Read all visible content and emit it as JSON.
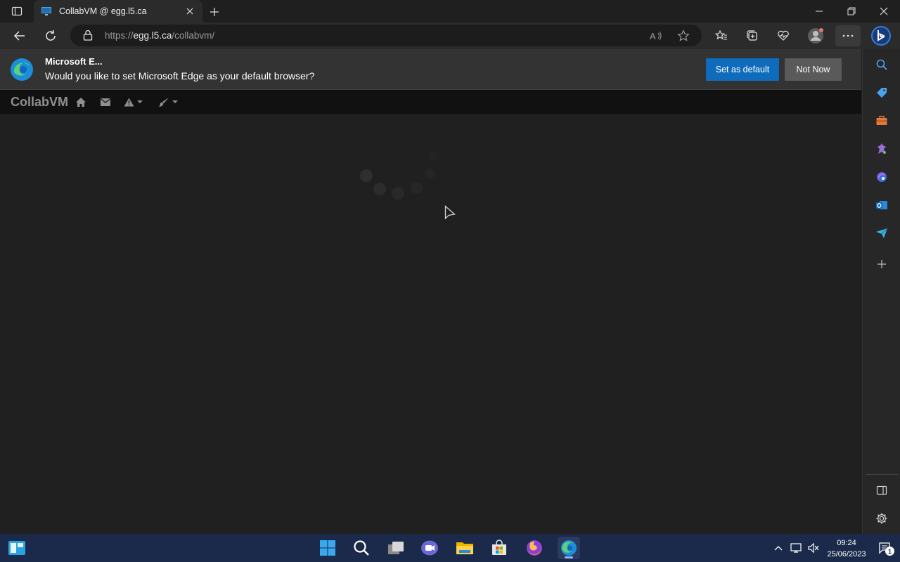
{
  "browser": {
    "tab_title": "CollabVM @ egg.l5.ca",
    "url_prefix": "https://",
    "url_host": "egg.l5.ca",
    "url_path": "/collabvm/"
  },
  "infobar": {
    "title": "Microsoft E...",
    "message": "Would you like to set Microsoft Edge as your default browser?",
    "set_default_label": "Set as default",
    "not_now_label": "Not Now"
  },
  "app": {
    "brand": "CollabVM",
    "nav_icons": [
      "home-icon",
      "envelope-icon",
      "warning-icon",
      "brush-icon"
    ]
  },
  "sidebar": {
    "items": [
      "search-icon",
      "tag-icon",
      "toolbox-icon",
      "games-icon",
      "copilot-icon",
      "outlook-icon",
      "send-icon",
      "add-icon"
    ],
    "bottom": [
      "panel-icon",
      "settings-icon"
    ]
  },
  "taskbar": {
    "time": "09:24",
    "date": "25/06/2023",
    "notification_count": "1",
    "apps": [
      "start-icon",
      "search-icon",
      "task-view-icon",
      "chat-icon",
      "file-explorer-icon",
      "store-icon",
      "firefox-icon",
      "edge-icon"
    ]
  },
  "colors": {
    "accent": "#0f6cbd",
    "taskbar": "#1b2a4a",
    "content_bg": "#202020"
  }
}
